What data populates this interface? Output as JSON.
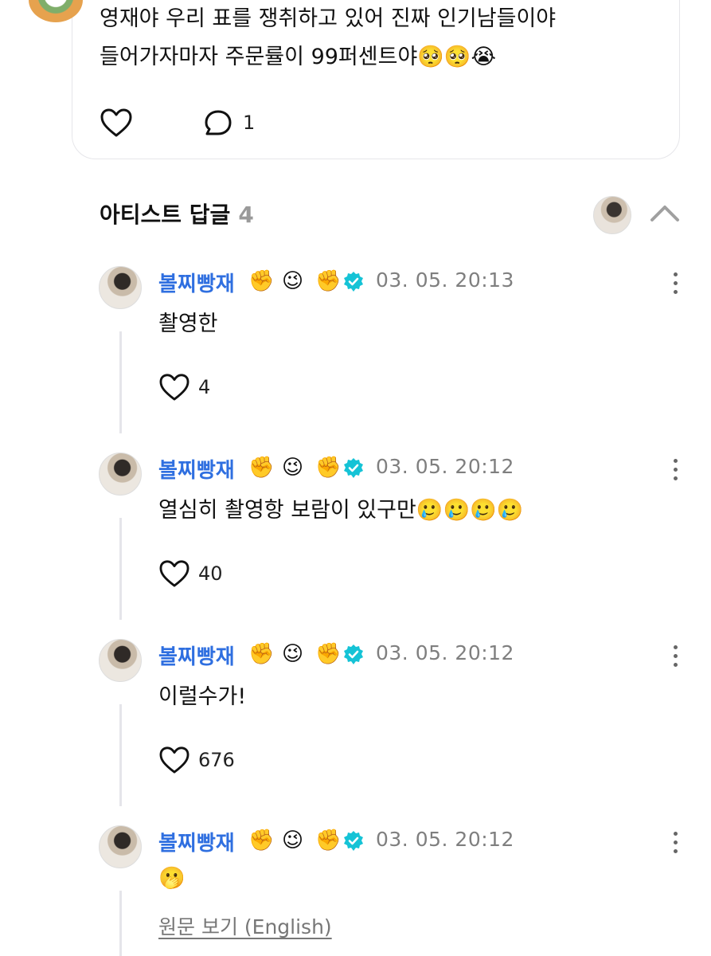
{
  "post": {
    "line1": "영재야 우리 표를 쟁취하고 있어 진짜 인기남들이야",
    "line2": "들어가자마자 주문률이 99퍼센트야🥺🥺😭",
    "like_icon": "heart-outline-icon",
    "comment_icon": "speech-bubble-icon",
    "comment_count": "1"
  },
  "section": {
    "title": "아티스트 답글",
    "count": "4",
    "collapse_icon": "chevron-up-icon"
  },
  "replies": [
    {
      "author": "볼찌빵재",
      "emojis": [
        "✊",
        "😉",
        "✊"
      ],
      "time": "03. 05. 20:13",
      "text": "촬영한",
      "likes": "4"
    },
    {
      "author": "볼찌빵재",
      "emojis": [
        "✊",
        "😉",
        "✊"
      ],
      "time": "03. 05. 20:12",
      "text": "열심히 촬영항 보람이 있구만🥲🥲🥲🥲",
      "likes": "40"
    },
    {
      "author": "볼찌빵재",
      "emojis": [
        "✊",
        "😉",
        "✊"
      ],
      "time": "03. 05. 20:12",
      "text": "이럴수가!",
      "likes": "676"
    },
    {
      "author": "볼찌빵재",
      "emojis": [
        "✊",
        "😉",
        "✊"
      ],
      "time": "03. 05. 20:12",
      "text": "🫢",
      "translate_link": "원문 보기 (English)"
    }
  ],
  "colors": {
    "author": "#2f6fe0",
    "verified": "#15c3d6",
    "meta": "#7f7f7f",
    "count_muted": "#9a9a9a"
  }
}
